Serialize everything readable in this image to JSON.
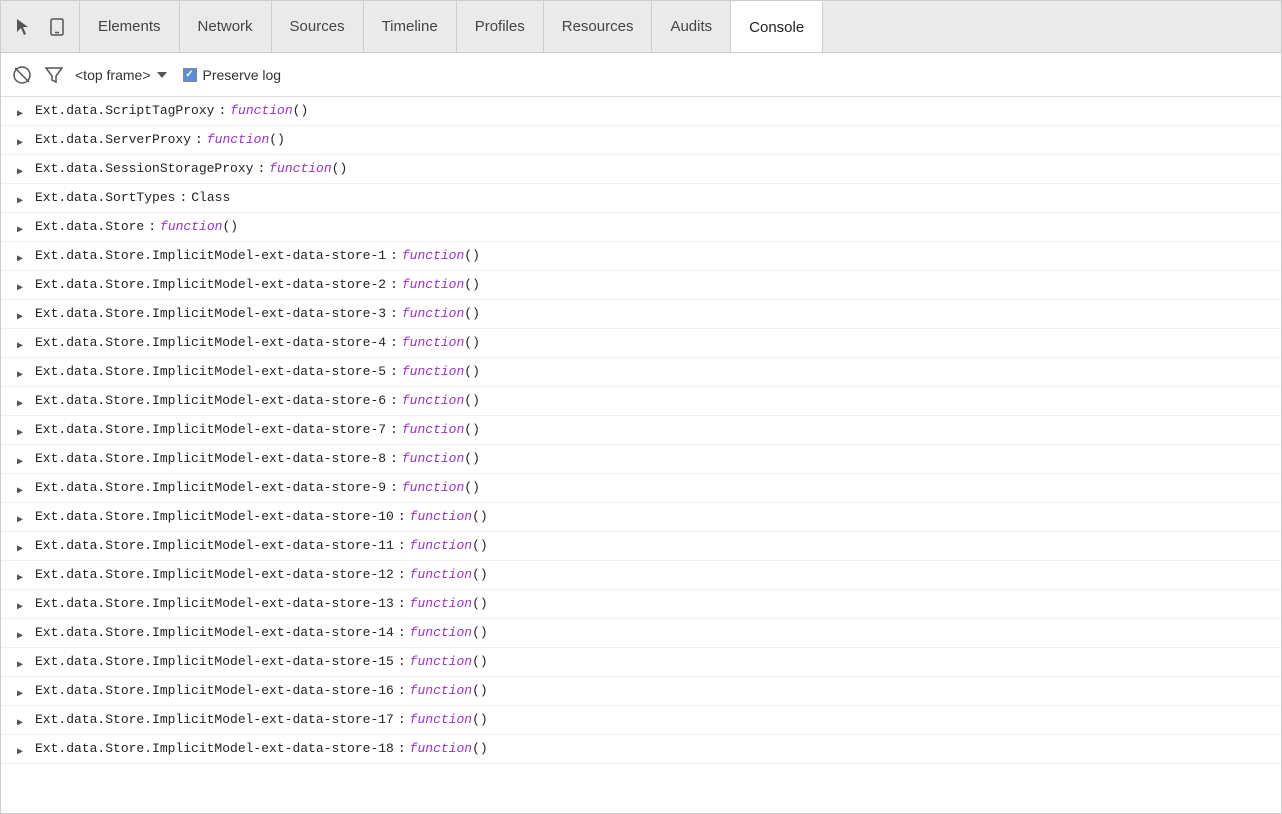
{
  "tabs": {
    "icons": [
      {
        "name": "cursor-icon",
        "symbol": "↖",
        "label": "Select element"
      },
      {
        "name": "device-icon",
        "symbol": "☐",
        "label": "Toggle device"
      }
    ],
    "items": [
      {
        "id": "elements",
        "label": "Elements",
        "active": false
      },
      {
        "id": "network",
        "label": "Network",
        "active": false
      },
      {
        "id": "sources",
        "label": "Sources",
        "active": false
      },
      {
        "id": "timeline",
        "label": "Timeline",
        "active": false
      },
      {
        "id": "profiles",
        "label": "Profiles",
        "active": false
      },
      {
        "id": "resources",
        "label": "Resources",
        "active": false
      },
      {
        "id": "audits",
        "label": "Audits",
        "active": false
      },
      {
        "id": "console",
        "label": "Console",
        "active": true
      }
    ]
  },
  "toolbar": {
    "no_entry_label": "⊘",
    "filter_label": "⊿",
    "frame_label": "<top frame>",
    "preserve_log_label": "Preserve log"
  },
  "console": {
    "lines": [
      {
        "id": 1,
        "name": "Ext.data.ScriptTagProxy",
        "colon": ":",
        "type": "function",
        "value": " ()"
      },
      {
        "id": 2,
        "name": "Ext.data.ServerProxy",
        "colon": ":",
        "type": "function",
        "value": " ()"
      },
      {
        "id": 3,
        "name": "Ext.data.SessionStorageProxy",
        "colon": ":",
        "type": "function",
        "value": " ()"
      },
      {
        "id": 4,
        "name": "Ext.data.SortTypes",
        "colon": ":",
        "type": "class",
        "value": "Class"
      },
      {
        "id": 5,
        "name": "Ext.data.Store",
        "colon": ":",
        "type": "function",
        "value": " ()"
      },
      {
        "id": 6,
        "name": "Ext.data.Store.ImplicitModel-ext-data-store-1",
        "colon": ":",
        "type": "function",
        "value": " ()"
      },
      {
        "id": 7,
        "name": "Ext.data.Store.ImplicitModel-ext-data-store-2",
        "colon": ":",
        "type": "function",
        "value": " ()"
      },
      {
        "id": 8,
        "name": "Ext.data.Store.ImplicitModel-ext-data-store-3",
        "colon": ":",
        "type": "function",
        "value": " ()"
      },
      {
        "id": 9,
        "name": "Ext.data.Store.ImplicitModel-ext-data-store-4",
        "colon": ":",
        "type": "function",
        "value": " ()"
      },
      {
        "id": 10,
        "name": "Ext.data.Store.ImplicitModel-ext-data-store-5",
        "colon": ":",
        "type": "function",
        "value": " ()"
      },
      {
        "id": 11,
        "name": "Ext.data.Store.ImplicitModel-ext-data-store-6",
        "colon": ":",
        "type": "function",
        "value": " ()"
      },
      {
        "id": 12,
        "name": "Ext.data.Store.ImplicitModel-ext-data-store-7",
        "colon": ":",
        "type": "function",
        "value": " ()"
      },
      {
        "id": 13,
        "name": "Ext.data.Store.ImplicitModel-ext-data-store-8",
        "colon": ":",
        "type": "function",
        "value": " ()"
      },
      {
        "id": 14,
        "name": "Ext.data.Store.ImplicitModel-ext-data-store-9",
        "colon": ":",
        "type": "function",
        "value": " ()"
      },
      {
        "id": 15,
        "name": "Ext.data.Store.ImplicitModel-ext-data-store-10",
        "colon": ":",
        "type": "function",
        "value": " ()"
      },
      {
        "id": 16,
        "name": "Ext.data.Store.ImplicitModel-ext-data-store-11",
        "colon": ":",
        "type": "function",
        "value": " ()"
      },
      {
        "id": 17,
        "name": "Ext.data.Store.ImplicitModel-ext-data-store-12",
        "colon": ":",
        "type": "function",
        "value": " ()"
      },
      {
        "id": 18,
        "name": "Ext.data.Store.ImplicitModel-ext-data-store-13",
        "colon": ":",
        "type": "function",
        "value": " ()"
      },
      {
        "id": 19,
        "name": "Ext.data.Store.ImplicitModel-ext-data-store-14",
        "colon": ":",
        "type": "function",
        "value": " ()"
      },
      {
        "id": 20,
        "name": "Ext.data.Store.ImplicitModel-ext-data-store-15",
        "colon": ":",
        "type": "function",
        "value": " ()"
      },
      {
        "id": 21,
        "name": "Ext.data.Store.ImplicitModel-ext-data-store-16",
        "colon": ":",
        "type": "function",
        "value": " ()"
      },
      {
        "id": 22,
        "name": "Ext.data.Store.ImplicitModel-ext-data-store-17",
        "colon": ":",
        "type": "function",
        "value": " ()"
      },
      {
        "id": 23,
        "name": "Ext.data.Store.ImplicitModel-ext-data-store-18",
        "colon": ":",
        "type": "function",
        "value": " ()"
      }
    ]
  }
}
